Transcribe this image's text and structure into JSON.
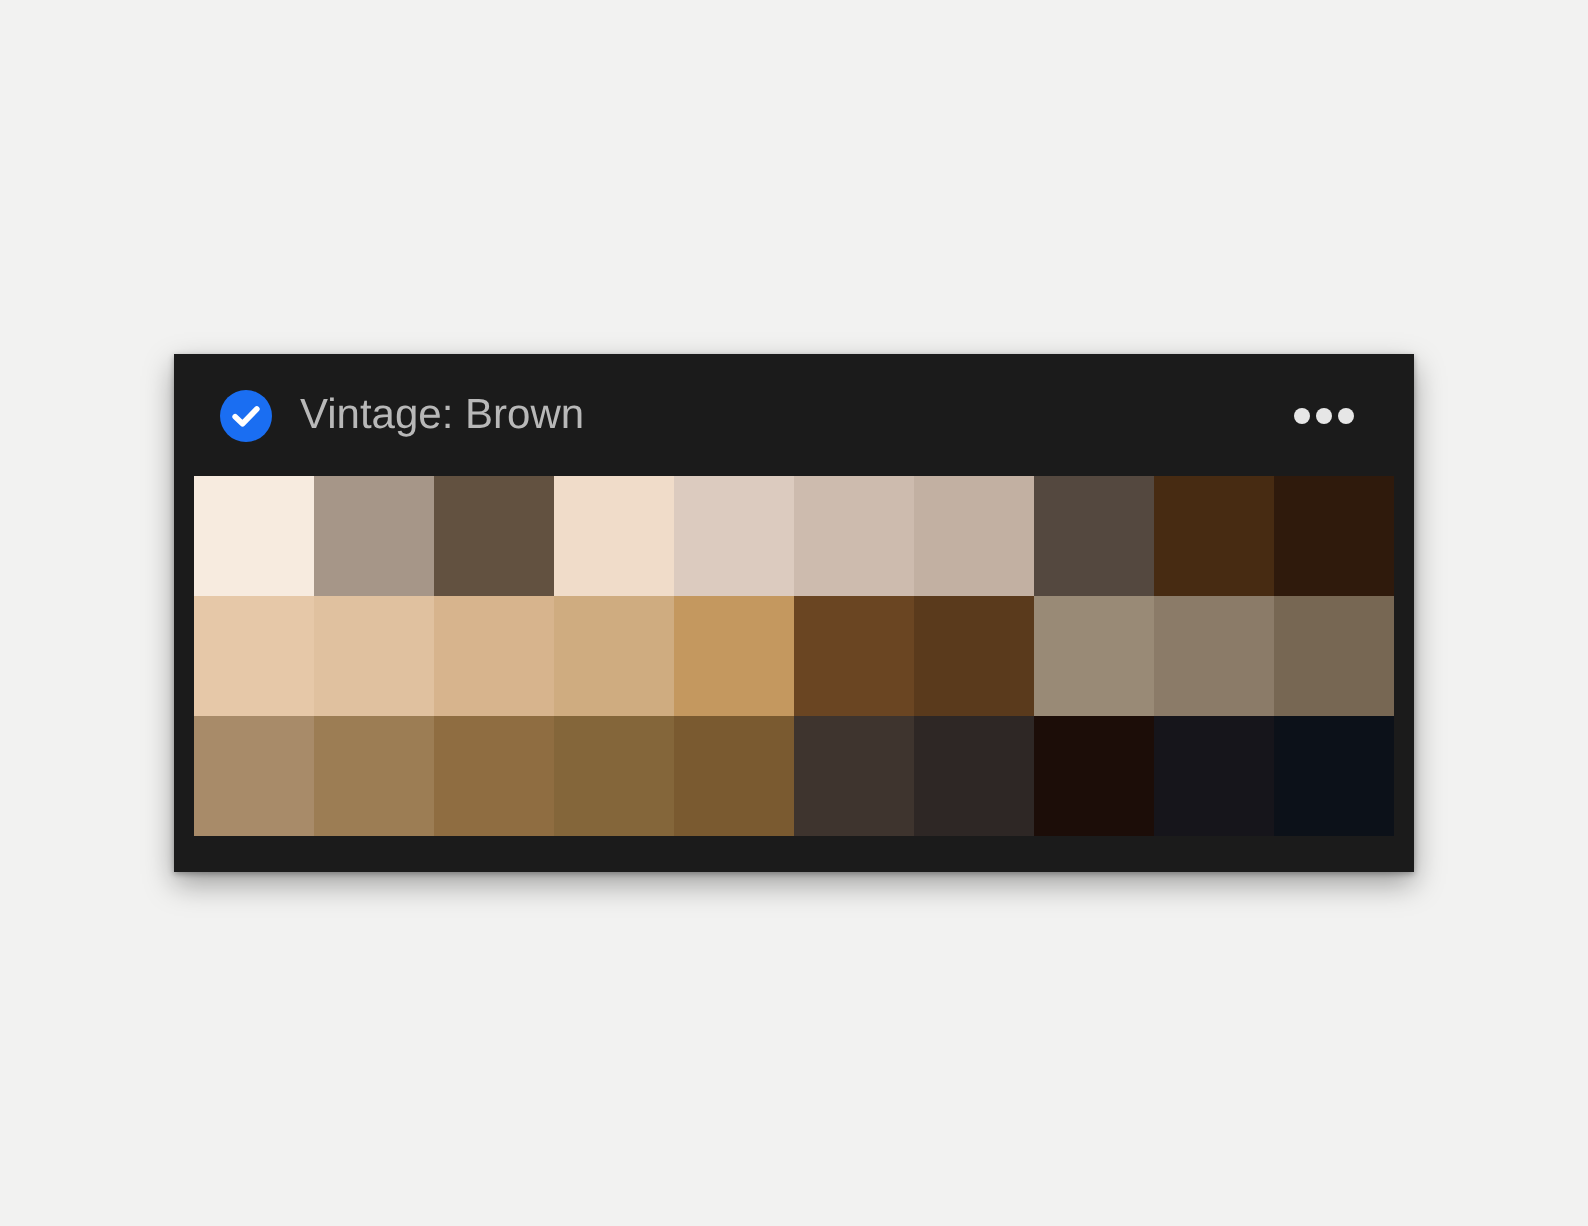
{
  "palette": {
    "title": "Vintage: Brown",
    "checked": true,
    "rows": [
      {
        "swatches": [
          {
            "color": "#f7ebdf"
          },
          {
            "color": "#a69688"
          },
          {
            "color": "#625140"
          },
          {
            "color": "#f0dcc9"
          },
          {
            "color": "#dccbbf"
          },
          {
            "color": "#cdbbae"
          },
          {
            "color": "#c2b0a2"
          },
          {
            "color": "#54483f"
          },
          {
            "color": "#472b12"
          },
          {
            "color": "#2f1a0c"
          }
        ]
      },
      {
        "swatches": [
          {
            "color": "#e6c8a8"
          },
          {
            "color": "#e0c19f"
          },
          {
            "color": "#d7b48d"
          },
          {
            "color": "#cfac80"
          },
          {
            "color": "#c4985f"
          },
          {
            "color": "#6a4522"
          },
          {
            "color": "#5a3a1c"
          },
          {
            "color": "#998a76"
          },
          {
            "color": "#8b7b68"
          },
          {
            "color": "#776753"
          }
        ]
      },
      {
        "swatches": [
          {
            "color": "#a88b69"
          },
          {
            "color": "#9c7d54"
          },
          {
            "color": "#8f6d41"
          },
          {
            "color": "#84663a"
          },
          {
            "color": "#7a5a30"
          },
          {
            "color": "#3e342e"
          },
          {
            "color": "#2e2725"
          },
          {
            "color": "#1c0d08"
          },
          {
            "color": "#16151b"
          },
          {
            "color": "#0c1119"
          }
        ]
      }
    ]
  }
}
